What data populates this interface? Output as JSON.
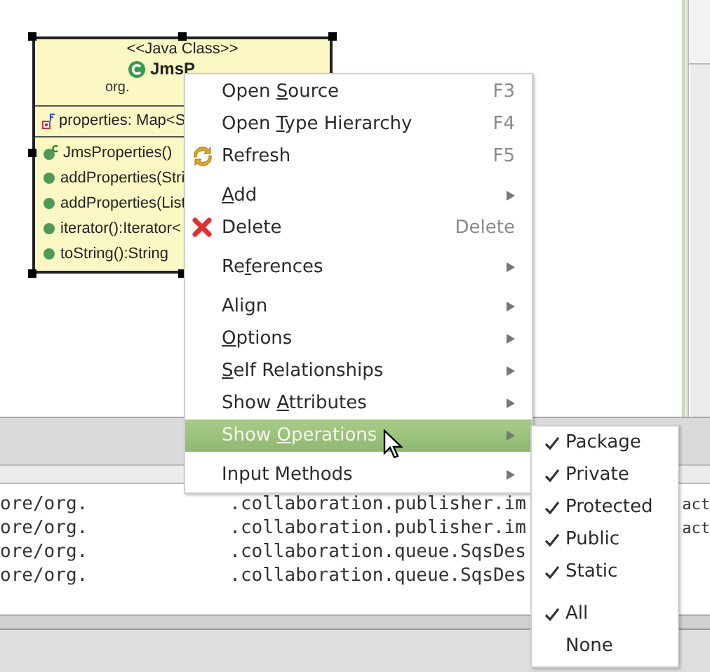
{
  "class_box": {
    "stereotype": "<<Java Class>>",
    "name": "JmsP",
    "package": "org.",
    "attributes": [
      {
        "text": "properties: Map<S"
      }
    ],
    "operations": [
      {
        "kind": "constructor",
        "text": "JmsProperties()"
      },
      {
        "kind": "method",
        "text": "addProperties(Stri"
      },
      {
        "kind": "method",
        "text": "addProperties(List"
      },
      {
        "kind": "method",
        "text": "iterator():Iterator<"
      },
      {
        "kind": "method",
        "text": "toString():String"
      }
    ]
  },
  "context_menu": {
    "items": [
      {
        "kind": "item",
        "before": "Open ",
        "key": "S",
        "after": "ource",
        "shortcut": "F3",
        "selected": false
      },
      {
        "kind": "item",
        "before": "Open ",
        "key": "T",
        "after": "ype Hierarchy",
        "shortcut": "F4",
        "selected": false
      },
      {
        "kind": "refresh",
        "before": "Refresh",
        "shortcut": "F5",
        "selected": false
      },
      {
        "kind": "separator"
      },
      {
        "kind": "submenu",
        "key": "A",
        "after": "dd",
        "selected": false
      },
      {
        "kind": "delete",
        "before": "Delete",
        "shortcut": "Delete",
        "selected": false
      },
      {
        "kind": "separator"
      },
      {
        "kind": "submenu",
        "before": "Re",
        "key": "f",
        "after": "erences",
        "selected": false
      },
      {
        "kind": "separator"
      },
      {
        "kind": "submenu",
        "before": "Align",
        "selected": false
      },
      {
        "kind": "submenu",
        "key": "O",
        "after": "ptions",
        "selected": false
      },
      {
        "kind": "submenu",
        "key": "S",
        "after": "elf Relationships",
        "selected": false
      },
      {
        "kind": "submenu",
        "before": "Show ",
        "key": "A",
        "after": "ttributes",
        "selected": false
      },
      {
        "kind": "submenu",
        "before": "Show ",
        "key": "O",
        "after": "perations",
        "selected": true
      },
      {
        "kind": "separator"
      },
      {
        "kind": "submenu",
        "before": "Input Methods",
        "selected": false
      }
    ]
  },
  "submenu": {
    "items": [
      {
        "kind": "check",
        "label": "Package",
        "checked": true
      },
      {
        "kind": "check",
        "label": "Private",
        "checked": true
      },
      {
        "kind": "check",
        "label": "Protected",
        "checked": true
      },
      {
        "kind": "check",
        "label": "Public",
        "checked": true
      },
      {
        "kind": "check",
        "label": "Static",
        "checked": true
      },
      {
        "kind": "separator"
      },
      {
        "kind": "check",
        "label": "All",
        "checked": true
      },
      {
        "kind": "check",
        "label": "None",
        "checked": false
      }
    ]
  },
  "console": {
    "lines": [
      {
        "prefix": "ore/org.",
        "rest": ".collaboration.publisher.im",
        "tail": "act"
      },
      {
        "prefix": "ore/org.",
        "rest": ".collaboration.publisher.im",
        "tail": "act"
      },
      {
        "prefix": "ore/org.",
        "rest": ".collaboration.queue.SqsDes"
      },
      {
        "prefix": "ore/org.",
        "rest": ".collaboration.queue.SqsDes"
      }
    ]
  }
}
